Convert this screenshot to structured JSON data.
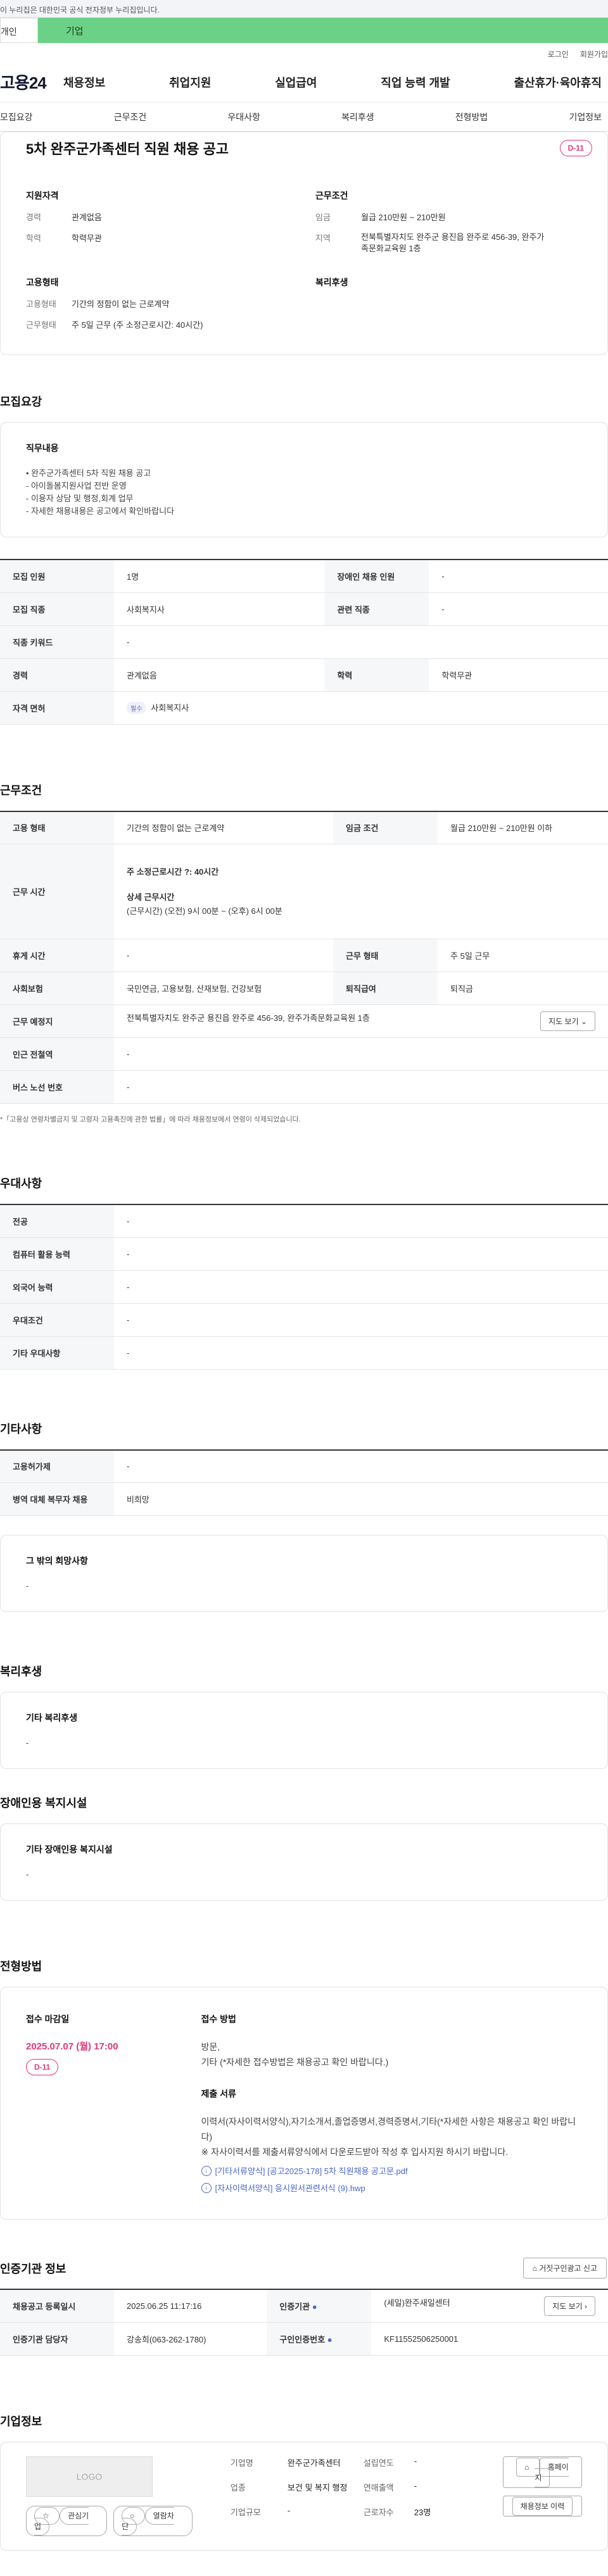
{
  "gov_bar": "이 누리집은 대한민국 공식 전자정부 누리집입니다.",
  "tabs": {
    "personal": "개인",
    "company": "기업"
  },
  "util": {
    "login": "로그인",
    "join": "회원가입"
  },
  "header": {
    "logo": "고용24",
    "menu": [
      "채용정보",
      "취업지원",
      "실업급여",
      "직업 능력 개발",
      "출산휴가·육아휴직"
    ]
  },
  "anchor_nav": [
    "모집요강",
    "근무조건",
    "우대사항",
    "복리후생",
    "전형방법",
    "기업정보"
  ],
  "summary": {
    "title": "5차 완주군가족센터 직원 채용 공고",
    "dday": "D-11",
    "qualification": {
      "heading": "지원자격",
      "rows": [
        {
          "k": "경력",
          "v": "관계없음"
        },
        {
          "k": "학력",
          "v": "학력무관"
        }
      ]
    },
    "conditions": {
      "heading": "근무조건",
      "rows": [
        {
          "k": "임금",
          "v": "월급 210만원 ~ 210만원"
        },
        {
          "k": "지역",
          "v": "전북특별자치도 완주군 용진읍 완주로 456-39, 완주가족문화교육원 1층"
        }
      ]
    },
    "employment": {
      "heading": "고용형태",
      "rows": [
        {
          "k": "고용형태",
          "v": "기간의 정함이 없는 근로계약"
        },
        {
          "k": "근무형태",
          "v": "주 5일 근무 (주 소정근로시간: 40시간)"
        }
      ]
    },
    "welfare_heading": "복리후생"
  },
  "recruit": {
    "title": "모집요강",
    "job_box": {
      "heading": "직무내용",
      "text": "• 완주군가족센터 5차 직원 채용 공고\n- 아이돌봄지원사업 전반 운영\n- 이용자 상담 및 행정,회계 업무\n- 자세한 채용내용은 공고에서 확인바랍니다"
    },
    "table": {
      "headcount_label": "모집 인원",
      "headcount": "1명",
      "disabled_label": "장애인 채용 인원",
      "disabled": "-",
      "job_label": "모집 직종",
      "job": "사회복지사",
      "related_label": "관련 직종",
      "related": "-",
      "keyword_label": "직종 키워드",
      "keyword": "-",
      "career_label": "경력",
      "career": "관계없음",
      "edu_label": "학력",
      "edu": "학력무관",
      "license_label": "자격 면허",
      "license_chip": "필수",
      "license": "사회복지사"
    }
  },
  "conditions": {
    "title": "근무조건",
    "type_label": "고용 형태",
    "type": "기간의 정함이 없는 근로계약",
    "wage_label": "임금 조건",
    "wage": "월급 210만원 ~ 210만원 이하",
    "hours_label": "근무 시간",
    "hours_weekly": "주 소정근로시간 ?: 40시간",
    "hours_detail_title": "상세 근무시간",
    "hours_detail": "(근무시간) (오전) 9시 00분 ~ (오후) 6시 00분",
    "rest_label": "휴게 시간",
    "rest": "-",
    "shift_label": "근무 형태",
    "shift": "주 5일 근무",
    "insurance_label": "사회보험",
    "insurance": "국민연금, 고용보험, 산재보험, 건강보험",
    "retire_label": "퇴직급여",
    "retire": "퇴직금",
    "place_label": "근무 예정지",
    "place": "전북특별자치도 완주군 용진읍 완주로 456-39, 완주가족문화교육원 1층",
    "map_btn": "지도 보기",
    "station_label": "인근 전철역",
    "station": "-",
    "bus_label": "버스 노선 번호",
    "bus": "-",
    "note": "*「고용상 연령차별금지 및 고령자 고용촉진에 관한 법률」에 따라 채용정보에서 연령이 삭제되었습니다."
  },
  "preference": {
    "title": "우대사항",
    "rows": [
      {
        "k": "전공",
        "v": "-"
      },
      {
        "k": "컴퓨터 활용 능력",
        "v": "-"
      },
      {
        "k": "외국어 능력",
        "v": "-"
      },
      {
        "k": "우대조건",
        "v": "-"
      },
      {
        "k": "기타 우대사항",
        "v": "-"
      }
    ]
  },
  "etc": {
    "title": "기타사항",
    "rows": [
      {
        "k": "고용허가제",
        "v": "-"
      },
      {
        "k": "병역 대체 복무자 채용",
        "v": "비희망"
      }
    ],
    "box_heading": "그 밖의 희망사항",
    "box_text": "-"
  },
  "welfare": {
    "title": "복리후생",
    "heading": "기타 복리후생",
    "text": "-"
  },
  "disabled_facility": {
    "title": "장애인용 복지시설",
    "heading": "기타 장애인용 복지시설",
    "text": "-"
  },
  "apply": {
    "title": "전형방법",
    "deadline_heading": "접수 마감일",
    "deadline": "2025.07.07 (월) 17:00",
    "dday": "D-11",
    "method_heading": "접수 방법",
    "method_text": "방문,\n기타 (*자세한 접수방법은 채용공고 확인 바랍니다.)",
    "docs_heading": "제출 서류",
    "docs_text": "이력서(자사이력서양식),자기소개서,졸업증명서,경력증명서,기타(*자세한 사항은 채용공고 확인 바랍니다)\n※ 자사이력서를 제출서류양식에서 다운로드받아 작성 후 입사지원 하시기 바랍니다.",
    "files": [
      "[기타서류양식] [공고2025-178] 5차 직원채용 공고문.pdf",
      "[자사이력서양식] 응시원서관련서식 (9).hwp"
    ]
  },
  "agency": {
    "title": "인증기관 정보",
    "report_btn": "거짓구인광고 신고",
    "reg_label": "채용공고 등록일시",
    "reg": "2025.06.25 11:17:16",
    "org_label": "인증기관",
    "org": "(세일)완주새일센터",
    "map_btn": "지도 보기",
    "manager_label": "인증기관 담당자",
    "manager": "강송희(063-262-1780)",
    "cert_label": "구인인증번호",
    "cert": "KF11552506250001"
  },
  "company": {
    "title": "기업정보",
    "logo": "LOGO",
    "fav": "관심기업",
    "open": "열람차단",
    "name_label": "기업명",
    "name": "완주군가족센터",
    "year_label": "설립연도",
    "year": "-",
    "industry_label": "업종",
    "industry": "보건 및 복지 행정",
    "sales_label": "연매출액",
    "sales": "-",
    "size_label": "기업규모",
    "size": "-",
    "workers_label": "근로자수",
    "workers": "23명",
    "home_btn": "홈페이지",
    "jobs_btn": "채용정보 이력"
  }
}
